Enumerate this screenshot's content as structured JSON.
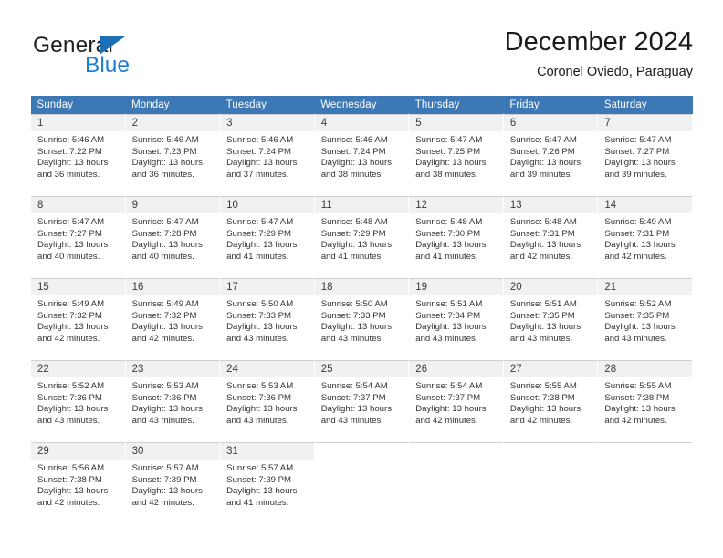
{
  "brand": {
    "name_part1": "General",
    "name_part2": "Blue",
    "triangle_icon": "triangle-icon",
    "color_dark": "#231f20",
    "color_blue": "#1b7fd4"
  },
  "header": {
    "title": "December 2024",
    "subtitle": "Coronel Oviedo, Paraguay",
    "accent_color": "#3b78b5"
  },
  "calendar": {
    "weekday_headers": [
      "Sunday",
      "Monday",
      "Tuesday",
      "Wednesday",
      "Thursday",
      "Friday",
      "Saturday"
    ],
    "labels": {
      "sunrise": "Sunrise:",
      "sunset": "Sunset:",
      "daylight": "Daylight:"
    },
    "weeks": [
      [
        {
          "day": "1",
          "sunrise": "Sunrise: 5:46 AM",
          "sunset": "Sunset: 7:22 PM",
          "daylight1": "Daylight: 13 hours",
          "daylight2": "and 36 minutes."
        },
        {
          "day": "2",
          "sunrise": "Sunrise: 5:46 AM",
          "sunset": "Sunset: 7:23 PM",
          "daylight1": "Daylight: 13 hours",
          "daylight2": "and 36 minutes."
        },
        {
          "day": "3",
          "sunrise": "Sunrise: 5:46 AM",
          "sunset": "Sunset: 7:24 PM",
          "daylight1": "Daylight: 13 hours",
          "daylight2": "and 37 minutes."
        },
        {
          "day": "4",
          "sunrise": "Sunrise: 5:46 AM",
          "sunset": "Sunset: 7:24 PM",
          "daylight1": "Daylight: 13 hours",
          "daylight2": "and 38 minutes."
        },
        {
          "day": "5",
          "sunrise": "Sunrise: 5:47 AM",
          "sunset": "Sunset: 7:25 PM",
          "daylight1": "Daylight: 13 hours",
          "daylight2": "and 38 minutes."
        },
        {
          "day": "6",
          "sunrise": "Sunrise: 5:47 AM",
          "sunset": "Sunset: 7:26 PM",
          "daylight1": "Daylight: 13 hours",
          "daylight2": "and 39 minutes."
        },
        {
          "day": "7",
          "sunrise": "Sunrise: 5:47 AM",
          "sunset": "Sunset: 7:27 PM",
          "daylight1": "Daylight: 13 hours",
          "daylight2": "and 39 minutes."
        }
      ],
      [
        {
          "day": "8",
          "sunrise": "Sunrise: 5:47 AM",
          "sunset": "Sunset: 7:27 PM",
          "daylight1": "Daylight: 13 hours",
          "daylight2": "and 40 minutes."
        },
        {
          "day": "9",
          "sunrise": "Sunrise: 5:47 AM",
          "sunset": "Sunset: 7:28 PM",
          "daylight1": "Daylight: 13 hours",
          "daylight2": "and 40 minutes."
        },
        {
          "day": "10",
          "sunrise": "Sunrise: 5:47 AM",
          "sunset": "Sunset: 7:29 PM",
          "daylight1": "Daylight: 13 hours",
          "daylight2": "and 41 minutes."
        },
        {
          "day": "11",
          "sunrise": "Sunrise: 5:48 AM",
          "sunset": "Sunset: 7:29 PM",
          "daylight1": "Daylight: 13 hours",
          "daylight2": "and 41 minutes."
        },
        {
          "day": "12",
          "sunrise": "Sunrise: 5:48 AM",
          "sunset": "Sunset: 7:30 PM",
          "daylight1": "Daylight: 13 hours",
          "daylight2": "and 41 minutes."
        },
        {
          "day": "13",
          "sunrise": "Sunrise: 5:48 AM",
          "sunset": "Sunset: 7:31 PM",
          "daylight1": "Daylight: 13 hours",
          "daylight2": "and 42 minutes."
        },
        {
          "day": "14",
          "sunrise": "Sunrise: 5:49 AM",
          "sunset": "Sunset: 7:31 PM",
          "daylight1": "Daylight: 13 hours",
          "daylight2": "and 42 minutes."
        }
      ],
      [
        {
          "day": "15",
          "sunrise": "Sunrise: 5:49 AM",
          "sunset": "Sunset: 7:32 PM",
          "daylight1": "Daylight: 13 hours",
          "daylight2": "and 42 minutes."
        },
        {
          "day": "16",
          "sunrise": "Sunrise: 5:49 AM",
          "sunset": "Sunset: 7:32 PM",
          "daylight1": "Daylight: 13 hours",
          "daylight2": "and 42 minutes."
        },
        {
          "day": "17",
          "sunrise": "Sunrise: 5:50 AM",
          "sunset": "Sunset: 7:33 PM",
          "daylight1": "Daylight: 13 hours",
          "daylight2": "and 43 minutes."
        },
        {
          "day": "18",
          "sunrise": "Sunrise: 5:50 AM",
          "sunset": "Sunset: 7:33 PM",
          "daylight1": "Daylight: 13 hours",
          "daylight2": "and 43 minutes."
        },
        {
          "day": "19",
          "sunrise": "Sunrise: 5:51 AM",
          "sunset": "Sunset: 7:34 PM",
          "daylight1": "Daylight: 13 hours",
          "daylight2": "and 43 minutes."
        },
        {
          "day": "20",
          "sunrise": "Sunrise: 5:51 AM",
          "sunset": "Sunset: 7:35 PM",
          "daylight1": "Daylight: 13 hours",
          "daylight2": "and 43 minutes."
        },
        {
          "day": "21",
          "sunrise": "Sunrise: 5:52 AM",
          "sunset": "Sunset: 7:35 PM",
          "daylight1": "Daylight: 13 hours",
          "daylight2": "and 43 minutes."
        }
      ],
      [
        {
          "day": "22",
          "sunrise": "Sunrise: 5:52 AM",
          "sunset": "Sunset: 7:36 PM",
          "daylight1": "Daylight: 13 hours",
          "daylight2": "and 43 minutes."
        },
        {
          "day": "23",
          "sunrise": "Sunrise: 5:53 AM",
          "sunset": "Sunset: 7:36 PM",
          "daylight1": "Daylight: 13 hours",
          "daylight2": "and 43 minutes."
        },
        {
          "day": "24",
          "sunrise": "Sunrise: 5:53 AM",
          "sunset": "Sunset: 7:36 PM",
          "daylight1": "Daylight: 13 hours",
          "daylight2": "and 43 minutes."
        },
        {
          "day": "25",
          "sunrise": "Sunrise: 5:54 AM",
          "sunset": "Sunset: 7:37 PM",
          "daylight1": "Daylight: 13 hours",
          "daylight2": "and 43 minutes."
        },
        {
          "day": "26",
          "sunrise": "Sunrise: 5:54 AM",
          "sunset": "Sunset: 7:37 PM",
          "daylight1": "Daylight: 13 hours",
          "daylight2": "and 42 minutes."
        },
        {
          "day": "27",
          "sunrise": "Sunrise: 5:55 AM",
          "sunset": "Sunset: 7:38 PM",
          "daylight1": "Daylight: 13 hours",
          "daylight2": "and 42 minutes."
        },
        {
          "day": "28",
          "sunrise": "Sunrise: 5:55 AM",
          "sunset": "Sunset: 7:38 PM",
          "daylight1": "Daylight: 13 hours",
          "daylight2": "and 42 minutes."
        }
      ],
      [
        {
          "day": "29",
          "sunrise": "Sunrise: 5:56 AM",
          "sunset": "Sunset: 7:38 PM",
          "daylight1": "Daylight: 13 hours",
          "daylight2": "and 42 minutes."
        },
        {
          "day": "30",
          "sunrise": "Sunrise: 5:57 AM",
          "sunset": "Sunset: 7:39 PM",
          "daylight1": "Daylight: 13 hours",
          "daylight2": "and 42 minutes."
        },
        {
          "day": "31",
          "sunrise": "Sunrise: 5:57 AM",
          "sunset": "Sunset: 7:39 PM",
          "daylight1": "Daylight: 13 hours",
          "daylight2": "and 41 minutes."
        },
        {
          "day": "",
          "sunrise": "",
          "sunset": "",
          "daylight1": "",
          "daylight2": ""
        },
        {
          "day": "",
          "sunrise": "",
          "sunset": "",
          "daylight1": "",
          "daylight2": ""
        },
        {
          "day": "",
          "sunrise": "",
          "sunset": "",
          "daylight1": "",
          "daylight2": ""
        },
        {
          "day": "",
          "sunrise": "",
          "sunset": "",
          "daylight1": "",
          "daylight2": ""
        }
      ]
    ]
  }
}
